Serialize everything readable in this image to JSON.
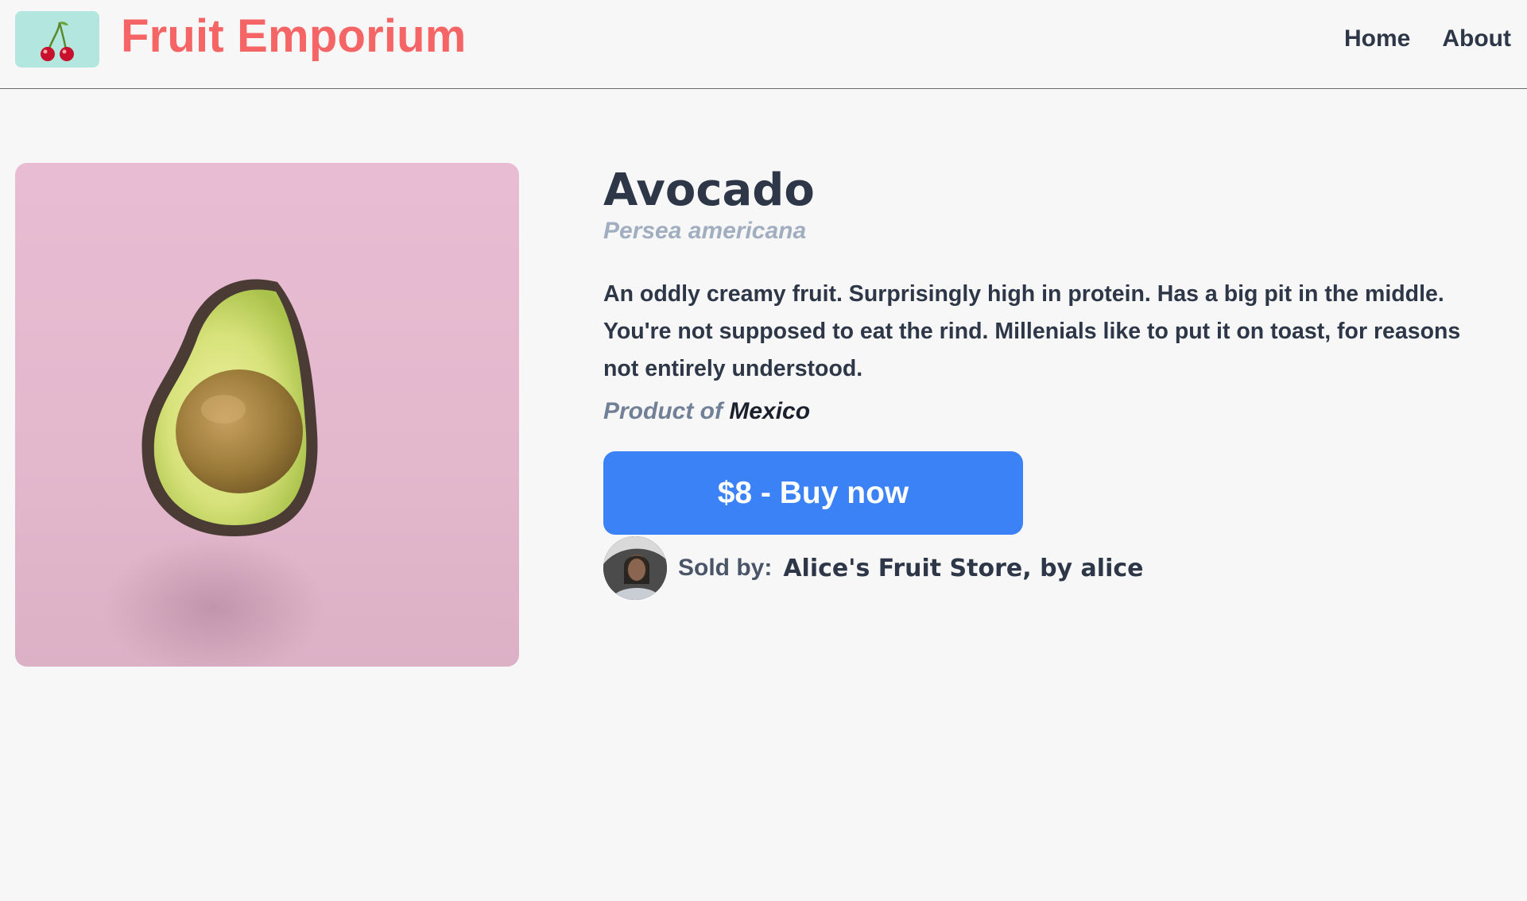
{
  "header": {
    "logo_icon": "cherries-icon",
    "brand": "Fruit Emporium",
    "nav": [
      {
        "label": "Home"
      },
      {
        "label": "About"
      }
    ]
  },
  "product": {
    "image_icon": "avocado-photo",
    "name": "Avocado",
    "scientific_name": "Persea americana",
    "description": "An oddly creamy fruit. Surprisingly high in protein. Has a big pit in the middle. You're not supposed to eat the rind. Millenials like to put it on toast, for reasons not entirely understood.",
    "origin_prefix": "Product of",
    "origin_country": "Mexico",
    "buy_label": "$8 - Buy now"
  },
  "seller": {
    "avatar_icon": "seller-avatar",
    "label": "Sold by:",
    "name": "Alice's Fruit Store, by alice"
  },
  "colors": {
    "background": "#f7f7f7",
    "brand": "#f56565",
    "logo_bg": "#b3e6de",
    "button": "#3b82f6",
    "image_bg": "#e6bad0",
    "text": "#2d3748"
  }
}
